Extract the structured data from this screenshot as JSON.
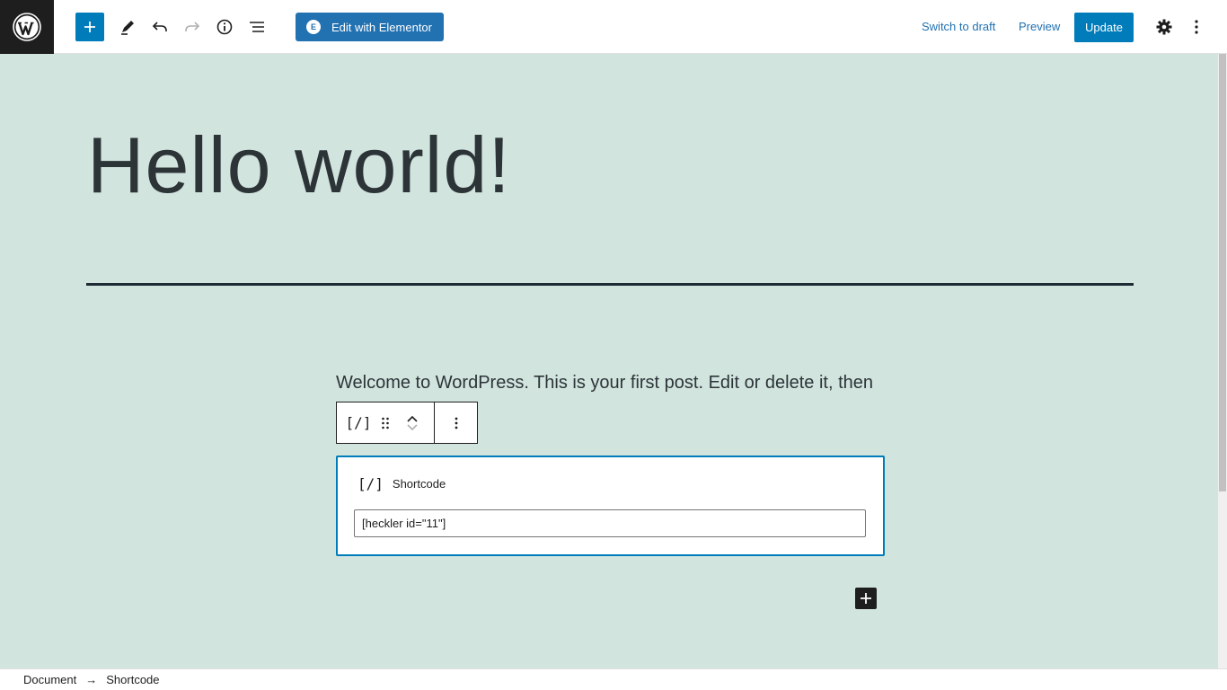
{
  "toolbar": {
    "elementor_label": "Edit with Elementor",
    "elementor_badge": "E",
    "switch_draft": "Switch to draft",
    "preview": "Preview",
    "update": "Update"
  },
  "post": {
    "title": "Hello world!",
    "paragraph": "Welcome to WordPress. This is your first post. Edit or delete it, then"
  },
  "block_toolbar": {
    "block_icon": "[/]"
  },
  "shortcode_block": {
    "icon": "[/]",
    "label": "Shortcode",
    "value": "[heckler id=\"11\"]"
  },
  "breadcrumb": {
    "items": [
      "Document",
      "Shortcode"
    ],
    "separator": "→"
  },
  "colors": {
    "accent": "#007cba",
    "elementor": "#2271b1",
    "canvas_bg": "#d2e4de",
    "dark": "#1e1e1e"
  },
  "icons": [
    "wordpress-logo-icon",
    "plus-icon",
    "pencil-icon",
    "undo-icon",
    "redo-icon",
    "info-icon",
    "list-view-icon",
    "gear-icon",
    "more-vertical-icon",
    "drag-handle-icon",
    "chevron-up-icon",
    "chevron-down-icon"
  ]
}
